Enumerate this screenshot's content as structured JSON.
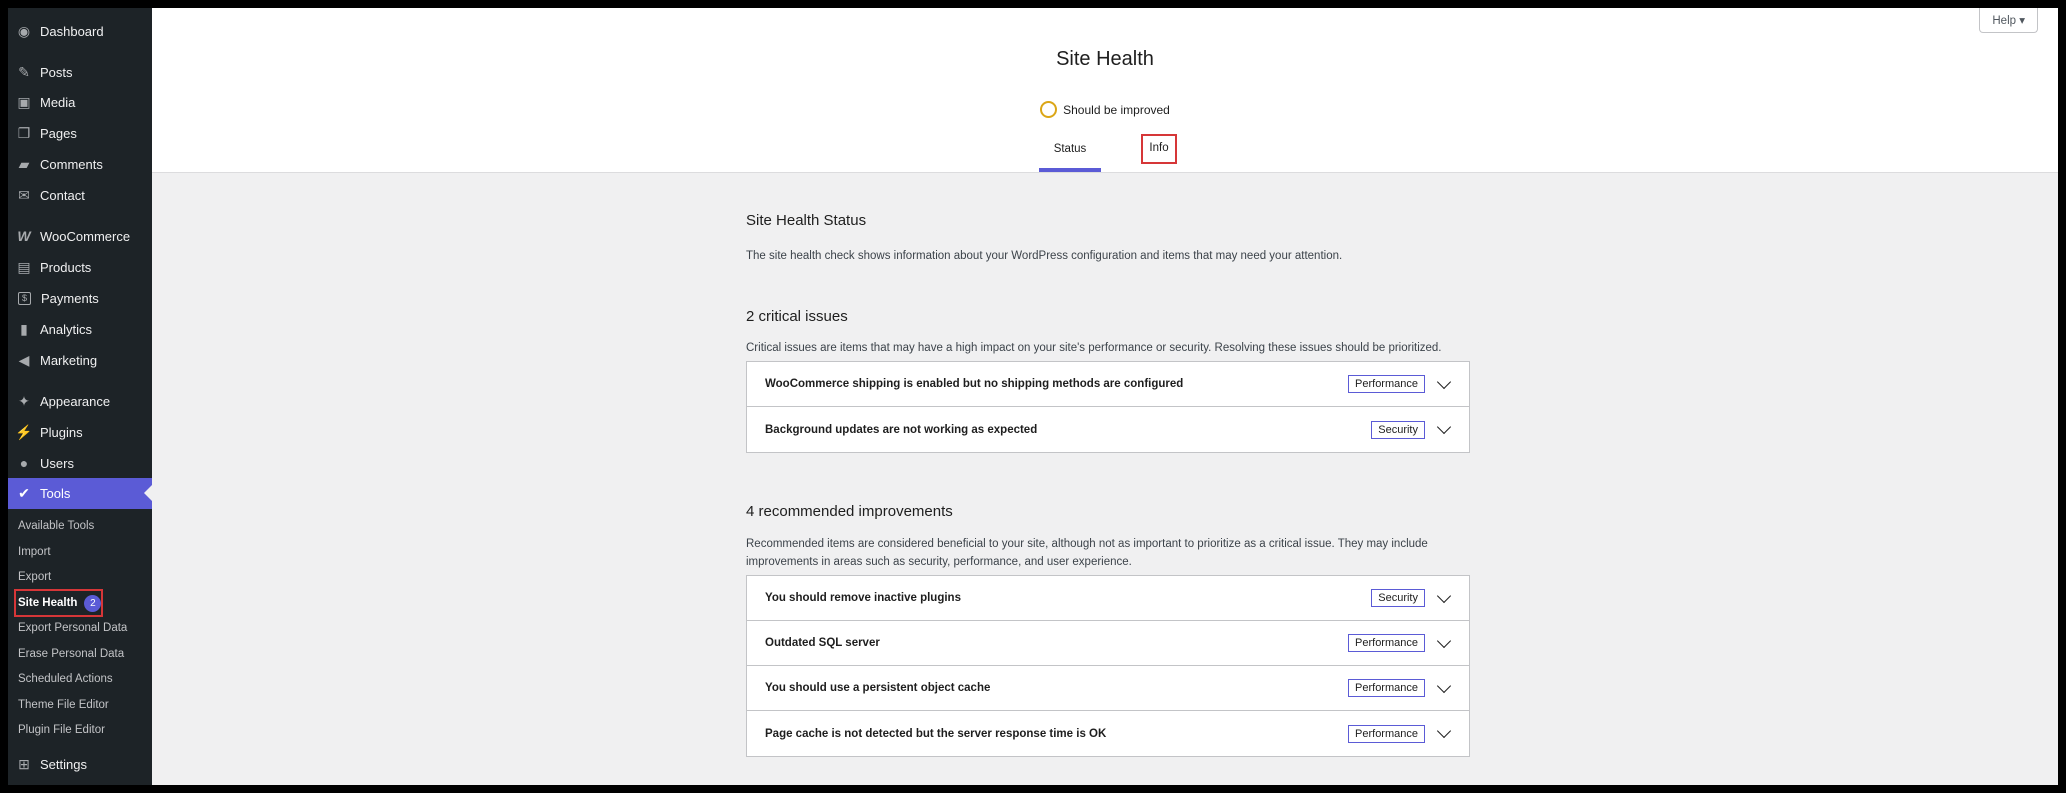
{
  "sidebar": {
    "menu": [
      {
        "label": "Dashboard",
        "icon": "dashboard-icon",
        "glyph": "◉"
      },
      {
        "label": "Posts",
        "icon": "pin-icon",
        "glyph": "✎"
      },
      {
        "label": "Media",
        "icon": "media-icon",
        "glyph": "▣"
      },
      {
        "label": "Pages",
        "icon": "pages-icon",
        "glyph": "❐"
      },
      {
        "label": "Comments",
        "icon": "comment-icon",
        "glyph": "▰"
      },
      {
        "label": "Contact",
        "icon": "mail-icon",
        "glyph": "✉"
      },
      {
        "label": "WooCommerce",
        "icon": "woo-icon",
        "glyph": "W"
      },
      {
        "label": "Products",
        "icon": "archive-icon",
        "glyph": "▤"
      },
      {
        "label": "Payments",
        "icon": "payments-icon",
        "glyph": "$"
      },
      {
        "label": "Analytics",
        "icon": "bar-chart-icon",
        "glyph": "▮"
      },
      {
        "label": "Marketing",
        "icon": "megaphone-icon",
        "glyph": "◀"
      },
      {
        "label": "Appearance",
        "icon": "brush-icon",
        "glyph": "✦"
      },
      {
        "label": "Plugins",
        "icon": "plug-icon",
        "glyph": "⚡"
      },
      {
        "label": "Users",
        "icon": "user-icon",
        "glyph": "●"
      },
      {
        "label": "Tools",
        "icon": "wrench-icon",
        "glyph": "✔"
      },
      {
        "label": "Settings",
        "icon": "settings-icon",
        "glyph": "⊞"
      }
    ],
    "submenu": [
      {
        "label": "Available Tools"
      },
      {
        "label": "Import"
      },
      {
        "label": "Export"
      },
      {
        "label": "Site Health",
        "badge": "2"
      },
      {
        "label": "Export Personal Data"
      },
      {
        "label": "Erase Personal Data"
      },
      {
        "label": "Scheduled Actions"
      },
      {
        "label": "Theme File Editor"
      },
      {
        "label": "Plugin File Editor"
      }
    ]
  },
  "header": {
    "help": "Help ▾",
    "title": "Site Health",
    "status": "Should be improved",
    "tabs": [
      "Status",
      "Info"
    ]
  },
  "main": {
    "section_title": "Site Health Status",
    "section_desc": "The site health check shows information about your WordPress configuration and items that may need your attention.",
    "critical": {
      "title": "2 critical issues",
      "desc": "Critical issues are items that may have a high impact on your site's performance or security. Resolving these issues should be prioritized.",
      "items": [
        {
          "title": "WooCommerce shipping is enabled but no shipping methods are configured",
          "badge": "Performance"
        },
        {
          "title": "Background updates are not working as expected",
          "badge": "Security"
        }
      ]
    },
    "recommended": {
      "title": "4 recommended improvements",
      "desc": "Recommended items are considered beneficial to your site, although not as important to prioritize as a critical issue. They may include improvements in areas such as security, performance, and user experience.",
      "items": [
        {
          "title": "You should remove inactive plugins",
          "badge": "Security"
        },
        {
          "title": "Outdated SQL server",
          "badge": "Performance"
        },
        {
          "title": "You should use a persistent object cache",
          "badge": "Performance"
        },
        {
          "title": "Page cache is not detected but the server response time is OK",
          "badge": "Performance"
        }
      ]
    }
  },
  "colors": {
    "accent": "#5b5bd6",
    "sidebar": "#1d2327",
    "warning": "#dba617",
    "highlight": "#d63638"
  }
}
